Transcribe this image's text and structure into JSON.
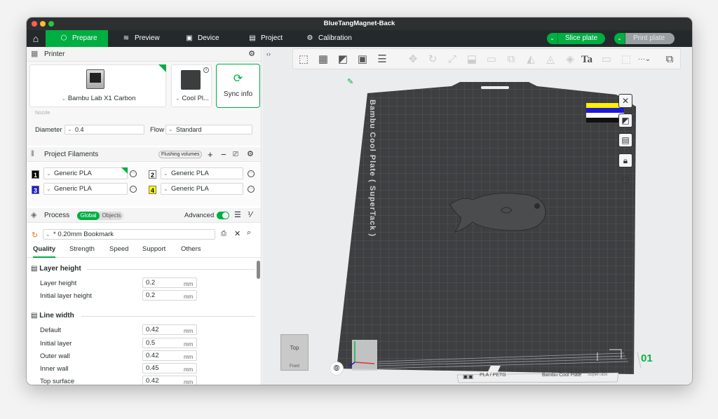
{
  "window": {
    "title": "BlueTangMagnet-Back"
  },
  "topbar": {
    "tabs": [
      {
        "label": "Prepare",
        "icon": "cube-icon"
      },
      {
        "label": "Preview",
        "icon": "layers-icon"
      },
      {
        "label": "Device",
        "icon": "device-icon"
      },
      {
        "label": "Project",
        "icon": "project-icon"
      },
      {
        "label": "Calibration",
        "icon": "calibration-icon"
      }
    ],
    "slice_label": "Slice plate",
    "print_label": "Print plate"
  },
  "printer": {
    "section_title": "Printer",
    "model": "Bambu Lab X1 Carbon",
    "plate": "Cool Pl...",
    "sync_label": "Sync info",
    "nozzle_label": "Nozzle",
    "diameter_label": "Diameter",
    "diameter_value": "0.4",
    "flow_label": "Flow",
    "flow_value": "Standard"
  },
  "filaments": {
    "section_title": "Project Filaments",
    "flushing_label": "Flushing volumes",
    "items": [
      {
        "num": "1",
        "name": "Generic PLA",
        "color": "#000000",
        "fg": "#ffffff"
      },
      {
        "num": "2",
        "name": "Generic PLA",
        "color": "#ffffff",
        "fg": "#000000"
      },
      {
        "num": "3",
        "name": "Generic PLA",
        "color": "#1a1ad6",
        "fg": "#ffffff"
      },
      {
        "num": "4",
        "name": "Generic PLA",
        "color": "#ffff00",
        "fg": "#000000"
      }
    ]
  },
  "process": {
    "section_title": "Process",
    "global_label": "Global",
    "objects_label": "Objects",
    "advanced_label": "Advanced",
    "preset": "* 0.20mm Bookmark",
    "tabs": [
      "Quality",
      "Strength",
      "Speed",
      "Support",
      "Others"
    ],
    "layer_height": {
      "title": "Layer height",
      "rows": [
        {
          "label": "Layer height",
          "value": "0.2",
          "unit": "mm"
        },
        {
          "label": "Initial layer height",
          "value": "0.2",
          "unit": "mm"
        }
      ]
    },
    "line_width": {
      "title": "Line width",
      "rows": [
        {
          "label": "Default",
          "value": "0.42",
          "unit": "mm"
        },
        {
          "label": "Initial layer",
          "value": "0.5",
          "unit": "mm"
        },
        {
          "label": "Outer wall",
          "value": "0.42",
          "unit": "mm"
        },
        {
          "label": "Inner wall",
          "value": "0.45",
          "unit": "mm"
        },
        {
          "label": "Top surface",
          "value": "0.42",
          "unit": "mm"
        }
      ]
    }
  },
  "viewport": {
    "plate_name": "Bambu Cool Plate ( SuperTack )",
    "plate_number": "01",
    "plate_footer_material": "PLA / PETG",
    "plate_footer_name": "Bambu Cool Plate",
    "plate_footer_sub": "SuperTack",
    "view_cube_top": "Top",
    "view_cube_front": "Front",
    "axis_x": "X"
  },
  "colors": {
    "accent": "#00ae42",
    "topbar": "#242a2c",
    "plate": "#3d3f41"
  }
}
